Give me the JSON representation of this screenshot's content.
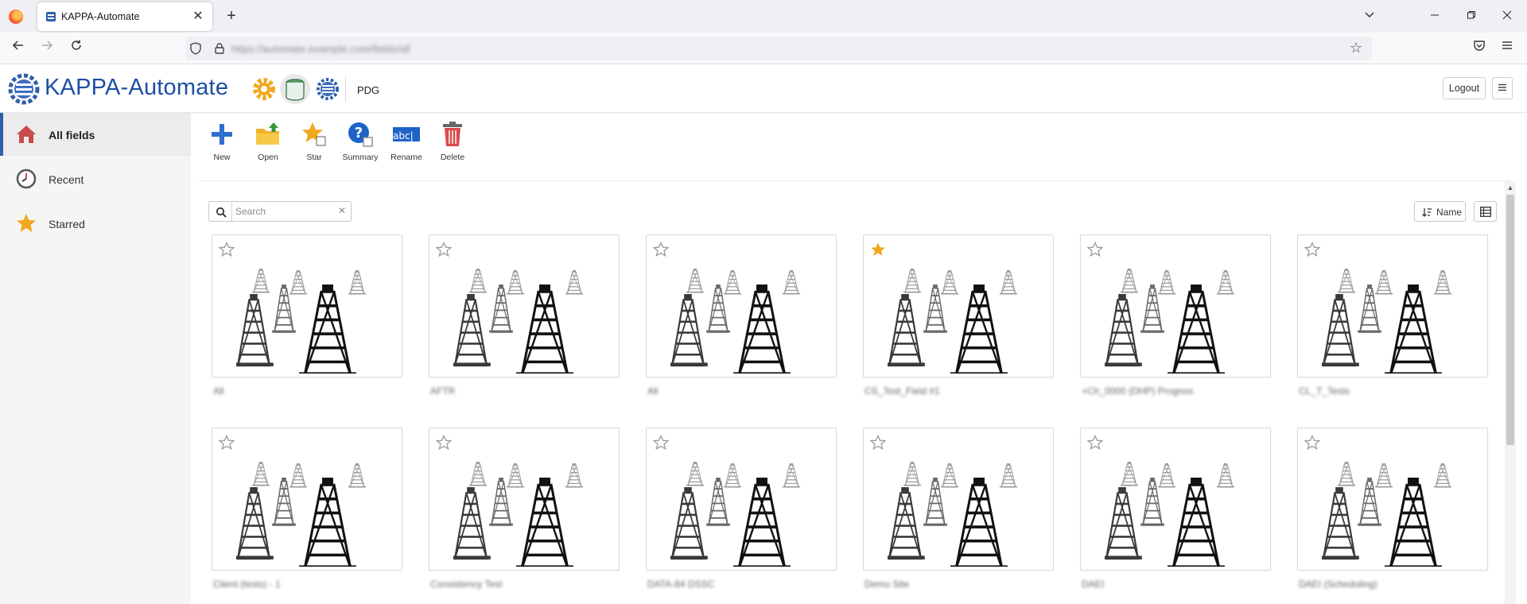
{
  "browser": {
    "tab_title": "KAPPA-Automate",
    "url": "https://automate.example.com/fields/all",
    "new_tab": "+",
    "tab_close": "✕"
  },
  "app": {
    "name": "KAPPA-Automate",
    "header_label": "PDG",
    "logout_label": "Logout",
    "accent_color": "#1d4fa3"
  },
  "sidebar": {
    "items": [
      {
        "label": "All fields",
        "icon": "home-icon",
        "active": true
      },
      {
        "label": "Recent",
        "icon": "clock-icon",
        "active": false
      },
      {
        "label": "Starred",
        "icon": "star-icon",
        "active": false
      }
    ]
  },
  "toolbar": {
    "new_label": "New",
    "open_label": "Open",
    "star_label": "Star",
    "summary_label": "Summary",
    "rename_label": "Rename",
    "delete_label": "Delete",
    "rename_icon_text": "abc|"
  },
  "list": {
    "search_placeholder": "Search",
    "search_value": "",
    "clear_glyph": "✕",
    "sort_label": "Name"
  },
  "fields": [
    {
      "name": "All",
      "starred": false
    },
    {
      "name": "AFTR",
      "starred": false
    },
    {
      "name": "All",
      "starred": false
    },
    {
      "name": "CS_Test_Field #1",
      "starred": true
    },
    {
      "name": "+Ch_0000 (DHP) Prognos",
      "starred": false
    },
    {
      "name": "CL_T_Tests",
      "starred": false
    },
    {
      "name": "Client (tests) - 1",
      "starred": false
    },
    {
      "name": "Consistency Test",
      "starred": false
    },
    {
      "name": "DATA-84 DSSC",
      "starred": false
    },
    {
      "name": "Demo Site",
      "starred": false
    },
    {
      "name": "DAEI",
      "starred": false
    },
    {
      "name": "DAEI (Scheduling)",
      "starred": false
    }
  ]
}
